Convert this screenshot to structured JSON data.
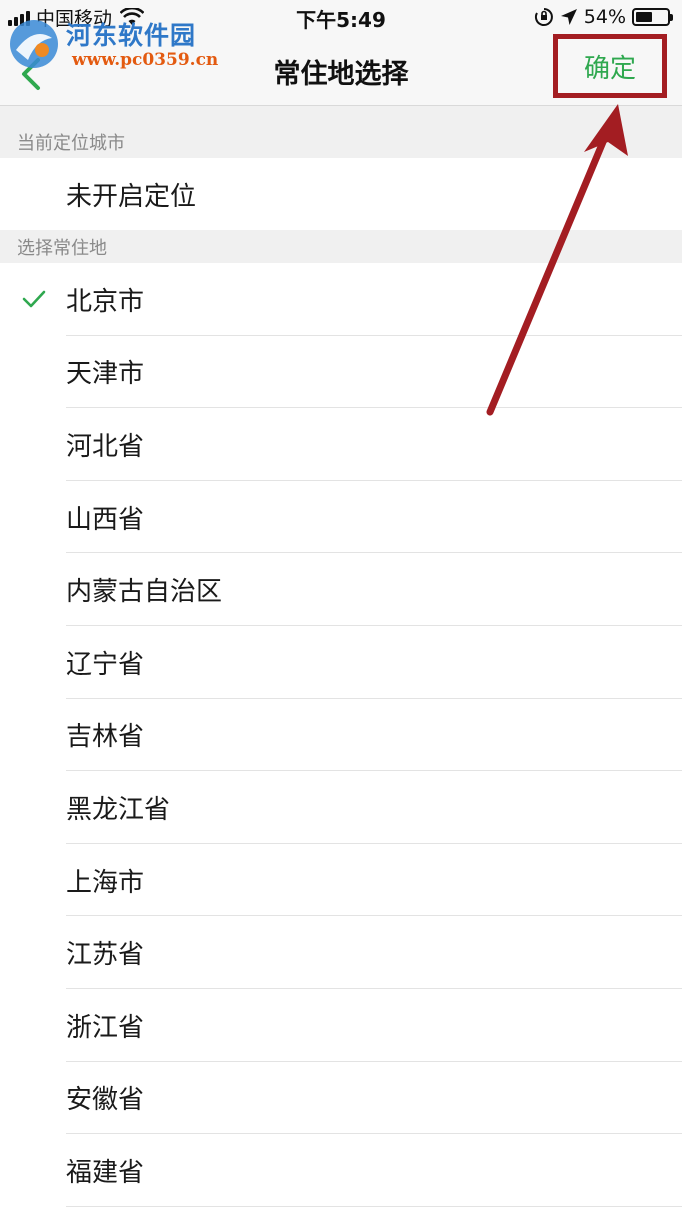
{
  "status_bar": {
    "carrier": "中国移动",
    "time": "下午5:49",
    "battery": "54%",
    "battery_level": 0.54
  },
  "watermark": {
    "name": "河东软件园",
    "url": "www.pc0359.cn"
  },
  "nav": {
    "title": "常住地选择",
    "confirm_label": "确定",
    "icons": {
      "back": "chevron-left-icon"
    }
  },
  "current_location": {
    "header": "当前定位城市",
    "value": "未开启定位"
  },
  "residence": {
    "header": "选择常住地",
    "selected": "北京市",
    "items": [
      "北京市",
      "天津市",
      "河北省",
      "山西省",
      "内蒙古自治区",
      "辽宁省",
      "吉林省",
      "黑龙江省",
      "上海市",
      "江苏省",
      "浙江省",
      "安徽省",
      "福建省"
    ]
  },
  "colors": {
    "accent_green": "#2fa84f",
    "annotation_red": "#a31d22"
  }
}
